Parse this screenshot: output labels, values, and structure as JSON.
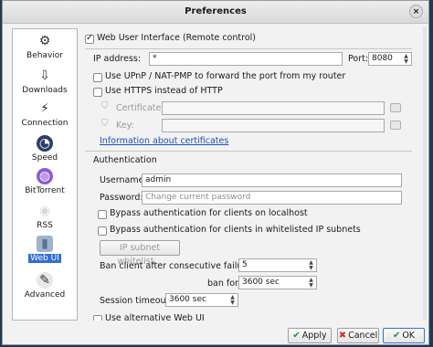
{
  "window": {
    "title": "Preferences",
    "close_symbol": "×"
  },
  "sidebar": {
    "items": [
      {
        "label": "Behavior",
        "icon": "⚙"
      },
      {
        "label": "Downloads",
        "icon": "⇩"
      },
      {
        "label": "Connection",
        "icon": "⚡"
      },
      {
        "label": "Speed",
        "icon": "◔"
      },
      {
        "label": "BitTorrent",
        "icon": "◍"
      },
      {
        "label": "RSS",
        "icon": "◉"
      },
      {
        "label": "Web UI",
        "icon": "▮"
      },
      {
        "label": "Advanced",
        "icon": "✎"
      }
    ],
    "active_index": 6
  },
  "webui": {
    "enable_label": "Web User Interface (Remote control)",
    "enable_checked": true,
    "ip_label": "IP address:",
    "ip_value": "*",
    "port_label": "Port:",
    "port_value": "8080",
    "upnp_label": "Use UPnP / NAT-PMP to forward the port from my router",
    "https_label": "Use HTTPS instead of HTTP",
    "certificate_label": "Certificate:",
    "key_label": "Key:",
    "cert_info_link": "Information about certificates"
  },
  "auth": {
    "section_title": "Authentication",
    "username_label": "Username:",
    "username_value": "admin",
    "password_label": "Password:",
    "password_placeholder": "Change current password",
    "bypass_localhost_label": "Bypass authentication for clients on localhost",
    "bypass_whitelist_label": "Bypass authentication for clients in whitelisted IP subnets",
    "whitelist_button": "IP subnet whitelist...",
    "ban_label": "Ban client after consecutive failures:",
    "ban_value": "5",
    "ban_for_label": "ban for:",
    "ban_for_value": "3600 sec",
    "session_timeout_label": "Session timeout:",
    "session_timeout_value": "3600 sec"
  },
  "alt_webui_label": "Use alternative Web UI",
  "buttons": {
    "apply": "Apply",
    "cancel": "Cancel",
    "ok": "OK"
  }
}
